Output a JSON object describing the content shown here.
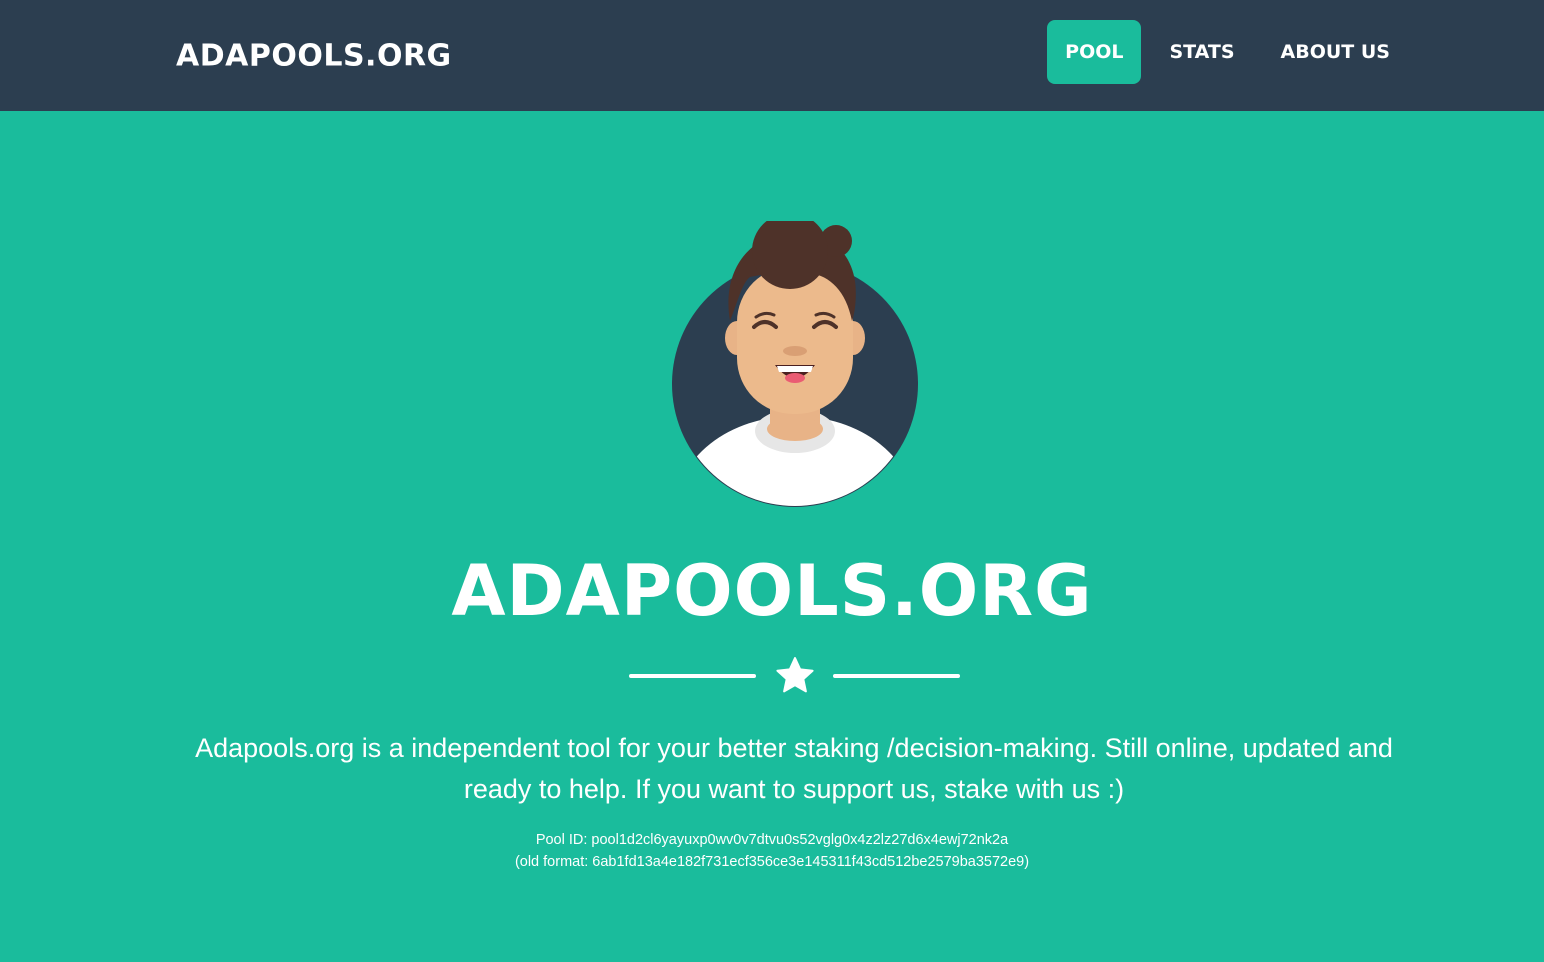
{
  "navbar": {
    "brand": "ADAPOOLS.ORG",
    "links": [
      {
        "label": "POOL",
        "active": true
      },
      {
        "label": "STATS",
        "active": false
      },
      {
        "label": "ABOUT US",
        "active": false
      }
    ]
  },
  "masthead": {
    "title": "ADAPOOLS.ORG",
    "lead": "Adapools.org is a independent tool for your better staking /decision-making. Still online, updated and ready to help. If you want to support us, stake with us :)",
    "pool_id_line": "Pool ID: pool1d2cl6yayuxp0wv0v7dtvu0s52vglg0x4z2lz27d6x4ewj72nk2a",
    "old_format_line": "(old format: 6ab1fd13a4e182f731ecf356ce3e145311f43cd512be2579ba3572e9)"
  },
  "icons": {
    "avatar": "avatar-illustration",
    "divider": "star-icon"
  },
  "colors": {
    "primary": "#1abc9c",
    "navbar": "#2c3e50",
    "text": "#ffffff"
  }
}
